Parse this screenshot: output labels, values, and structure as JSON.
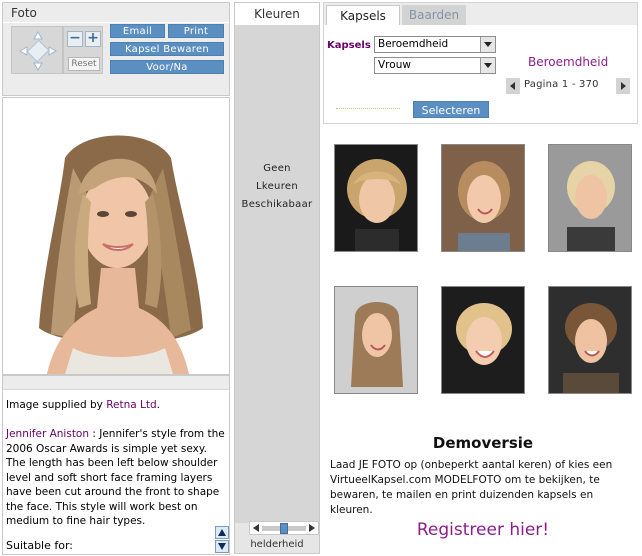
{
  "foto_panel": {
    "title": "Foto",
    "reset_label": "Reset",
    "buttons": {
      "email": "Email",
      "print": "Print",
      "save": "Kapsel Bewaren",
      "before_after": "Voor/Na"
    }
  },
  "caption": {
    "supplied_prefix": "Image supplied by ",
    "supplied_link": "Retna Ltd",
    "supplied_suffix": ".",
    "name": "Jennifer Aniston",
    "description": " : Jennifer's style from the 2006 Oscar Awards is simple yet sexy. The length has been left below shoulder level and soft short face framing layers have been cut around the front to shape the face. This style will work best on medium to fine hair types.",
    "suitable_label": "Suitable for:"
  },
  "kleuren": {
    "title": "Kleuren",
    "message_line1": "Geen",
    "message_line2": "Lkeuren",
    "message_line3": "Beschikabaar",
    "brightness_label": "helderheid",
    "brightness_level": 0.5
  },
  "tabs": {
    "kapsels": "Kapsels",
    "baarden": "Baarden"
  },
  "filters": {
    "label": "Kapsels",
    "category_value": "Beroemdheid",
    "gender_value": "Vrouw",
    "category_title": "Beroemdheid",
    "page_text": "Pagina 1 - 370",
    "select_button": "Selecteren"
  },
  "demo": {
    "title": "Demoversie",
    "text": "Laad JE FOTO op (onbeperkt aantal keren) of kies een VirtueelKapsel.com MODELFOTO om te bekijken, te bewaren, te mailen en print duizenden kapsels en kleuren.",
    "register": "Registreer hier!"
  },
  "colors": {
    "accent_blue": "#5b8ec1",
    "purple": "#660066",
    "magenta": "#8b1e8b"
  }
}
